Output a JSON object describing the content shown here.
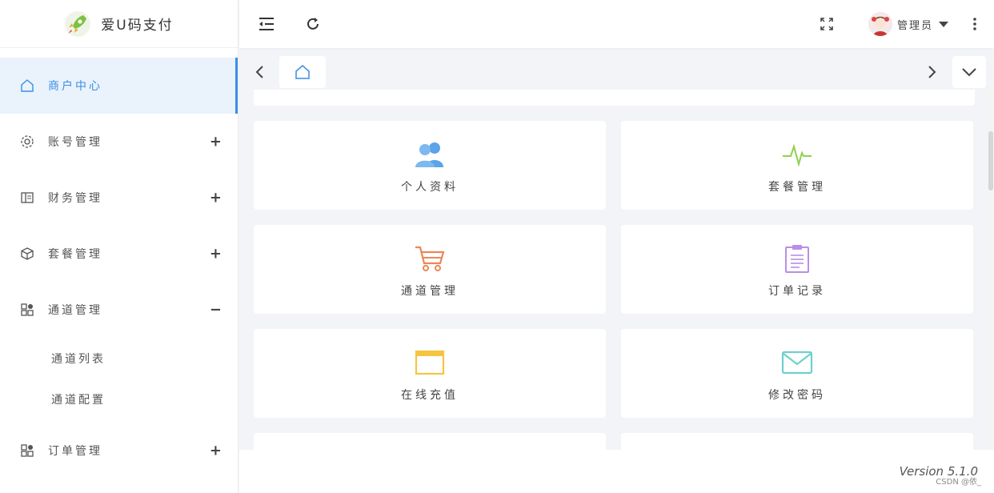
{
  "app": {
    "logo_text": "爱U码支付",
    "brand_color": "#3a8ee6"
  },
  "sidebar": {
    "items": [
      {
        "label": "商户中心",
        "icon": "home-icon",
        "active": true
      },
      {
        "label": "账号管理",
        "icon": "gear-icon",
        "toggle": "+"
      },
      {
        "label": "财务管理",
        "icon": "ledger-icon",
        "toggle": "+"
      },
      {
        "label": "套餐管理",
        "icon": "cube-icon",
        "toggle": "+"
      },
      {
        "label": "通道管理",
        "icon": "apps-icon",
        "toggle": "−",
        "expanded": true
      },
      {
        "label": "订单管理",
        "icon": "apps-icon",
        "toggle": "+"
      }
    ],
    "sub_items": [
      {
        "label": "通道列表"
      },
      {
        "label": "通道配置"
      }
    ]
  },
  "header": {
    "user_name": "管理员"
  },
  "cards": [
    {
      "label": "个人资料",
      "icon": "users-icon",
      "color": "#5ba3ea"
    },
    {
      "label": "套餐管理",
      "icon": "pulse-icon",
      "color": "#8fd14f"
    },
    {
      "label": "通道管理",
      "icon": "cart-icon",
      "color": "#e9885a"
    },
    {
      "label": "订单记录",
      "icon": "clipboard-icon",
      "color": "#b98ee8"
    },
    {
      "label": "在线充值",
      "icon": "card-icon",
      "color": "#f5c542"
    },
    {
      "label": "修改密码",
      "icon": "mail-icon",
      "color": "#6fd0cc"
    }
  ],
  "footer": {
    "version": "Version 5.1.0",
    "watermark": "CSDN @依_"
  }
}
